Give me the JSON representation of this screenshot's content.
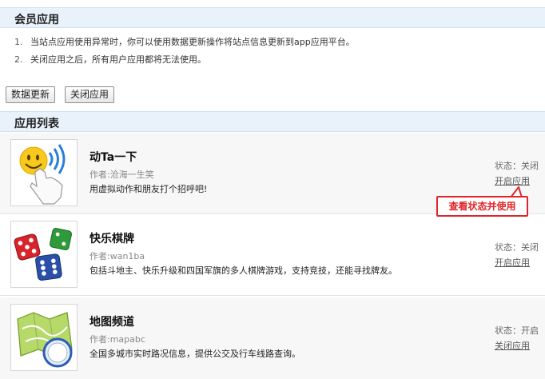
{
  "member_section": {
    "title": "会员应用"
  },
  "notes": [
    {
      "num": "1.",
      "text": "当站点应用使用异常时，你可以使用数据更新操作将站点信息更新到app应用平台。"
    },
    {
      "num": "2.",
      "text": "关闭应用之后，所有用户应用都将无法使用。"
    }
  ],
  "buttons": {
    "update": "数据更新",
    "close_app": "关闭应用"
  },
  "list_section": {
    "title": "应用列表"
  },
  "apps": [
    {
      "name": "动Ta一下",
      "author": "作者:沧海一生笑",
      "description": "用虚拟动作和朋友打个招呼吧!",
      "status": "状态：关闭",
      "action": "开启应用",
      "icon": "poke-emoji-icon"
    },
    {
      "name": "快乐棋牌",
      "author": "作者:wan1ba",
      "description": "包括斗地主、快乐升级和四国军旗的多人棋牌游戏，支持竞技，还能寻找牌友。",
      "status": "状态：关闭",
      "action": "开启应用",
      "icon": "dice-icon"
    },
    {
      "name": "地图频道",
      "author": "作者:mapabc",
      "description": "全国多城市实时路况信息，提供公交及行车线路查询。",
      "status": "状态：开启",
      "action": "关闭应用",
      "icon": "map-compass-icon"
    }
  ],
  "tooltip": {
    "text": "查看状态并使用",
    "color": "#e0252a"
  }
}
